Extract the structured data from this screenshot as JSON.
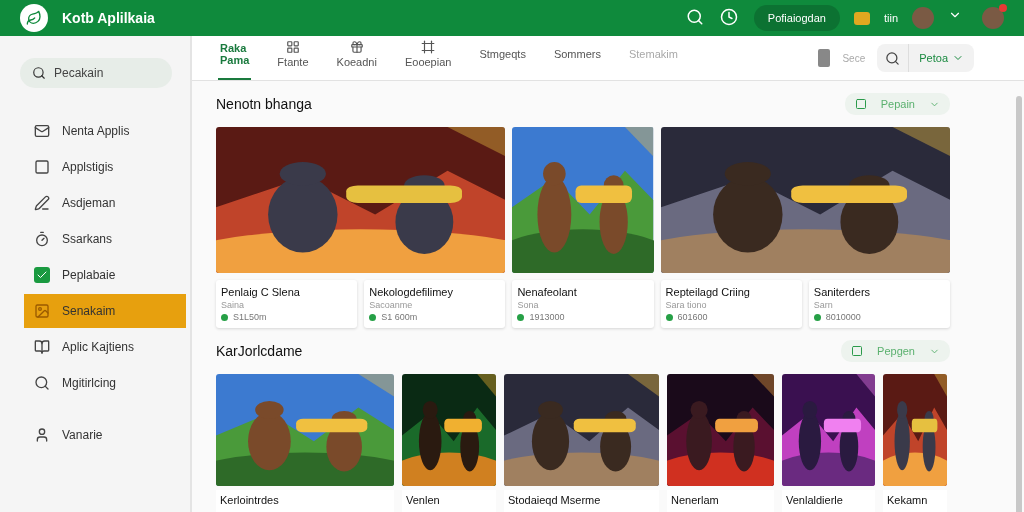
{
  "header": {
    "title": "Kotb Aplilkaia",
    "account_button": "Pofiaiogdan",
    "coins": "tiin"
  },
  "sidebar": {
    "search": {
      "placeholder": "Pecakain"
    },
    "items": [
      {
        "label": "Nenta Applis",
        "selected": false
      },
      {
        "label": "Applstigis",
        "selected": false
      },
      {
        "label": "Asdjeman",
        "selected": false
      },
      {
        "label": "Ssarkans",
        "selected": false
      },
      {
        "label": "Peplabaie",
        "selected": false
      },
      {
        "label": "Senakaim",
        "selected": true
      },
      {
        "label": "Aplic Kajtiens",
        "selected": false
      },
      {
        "label": "Mgitirlcing",
        "selected": false
      },
      {
        "label": "Vanarie",
        "selected": false
      }
    ]
  },
  "tabs": [
    {
      "label": "Raka Pama",
      "selected": true,
      "disabled": false
    },
    {
      "label": "Ftante",
      "selected": false,
      "disabled": false
    },
    {
      "label": "Koeadni",
      "selected": false,
      "disabled": false
    },
    {
      "label": "Eooepian",
      "selected": false,
      "disabled": false
    },
    {
      "label": "Stmgeqts",
      "selected": false,
      "disabled": false
    },
    {
      "label": "Sommers",
      "selected": false,
      "disabled": false
    },
    {
      "label": "Stemakim",
      "selected": false,
      "disabled": true
    }
  ],
  "toolbar": {
    "save_label": "Sece",
    "filter": "Petoa"
  },
  "sections": [
    {
      "title": "Nenotn bhanga",
      "filter": "Pepain",
      "items": [
        {
          "title": "Penlaig C Slena",
          "subtitle": "Saina",
          "stat": "S1L50m"
        },
        {
          "title": "Nekologdefilimey",
          "subtitle": "Sacoanme",
          "stat": "S1 600m"
        },
        {
          "title": "Nenafeolant",
          "subtitle": "Sona",
          "stat": "1913000"
        },
        {
          "title": "Repteilagd Criing",
          "subtitle": "Sara tiono",
          "stat": "601600"
        },
        {
          "title": "Saniterders",
          "subtitle": "Sarn",
          "stat": "8010000"
        }
      ]
    },
    {
      "title": "KarJorlcdame",
      "filter": "Pepgen",
      "tiles": [
        {
          "title": "Kerlointrdes"
        },
        {
          "title": "Venlen"
        },
        {
          "title": "Stodaieqd Mserme"
        },
        {
          "title": "Nenerlam"
        },
        {
          "title": "Venlaldierle"
        },
        {
          "title": "Kekamn"
        }
      ]
    }
  ]
}
